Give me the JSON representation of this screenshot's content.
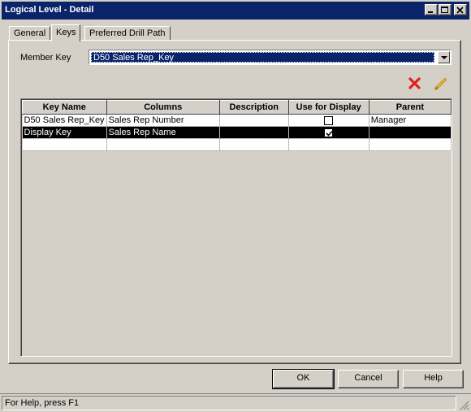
{
  "window": {
    "title": "Logical Level - Detail",
    "controls": [
      "minimize-icon",
      "maximize-icon",
      "close-icon"
    ]
  },
  "tabs": [
    {
      "label": "General",
      "active": false
    },
    {
      "label": "Keys",
      "active": true
    },
    {
      "label": "Preferred Drill Path",
      "active": false
    }
  ],
  "member_key": {
    "label": "Member Key",
    "value": "D50 Sales Rep_Key"
  },
  "toolbar": {
    "delete_icon": "red-x-delete-icon",
    "edit_icon": "pencil-edit-icon"
  },
  "table": {
    "headers": [
      "Key Name",
      "Columns",
      "Description",
      "Use for Display",
      "Parent"
    ],
    "rows": [
      {
        "key_name": "D50 Sales Rep_Key",
        "columns": "Sales Rep Number",
        "description": "",
        "use_for_display": false,
        "parent": "Manager",
        "selected": false
      },
      {
        "key_name": "Display Key",
        "columns": "Sales Rep Name",
        "description": "",
        "use_for_display": true,
        "parent": "",
        "selected": true
      },
      {
        "key_name": "",
        "columns": "",
        "description": "",
        "use_for_display": null,
        "parent": "",
        "selected": false
      }
    ]
  },
  "buttons": {
    "ok": "OK",
    "cancel": "Cancel",
    "help": "Help"
  },
  "status": {
    "text": "For Help, press F1"
  },
  "colors": {
    "titlebar": "#0a246a",
    "face": "#d4d0c8",
    "selection": "#000000",
    "delete_icon": "#e0201c"
  }
}
